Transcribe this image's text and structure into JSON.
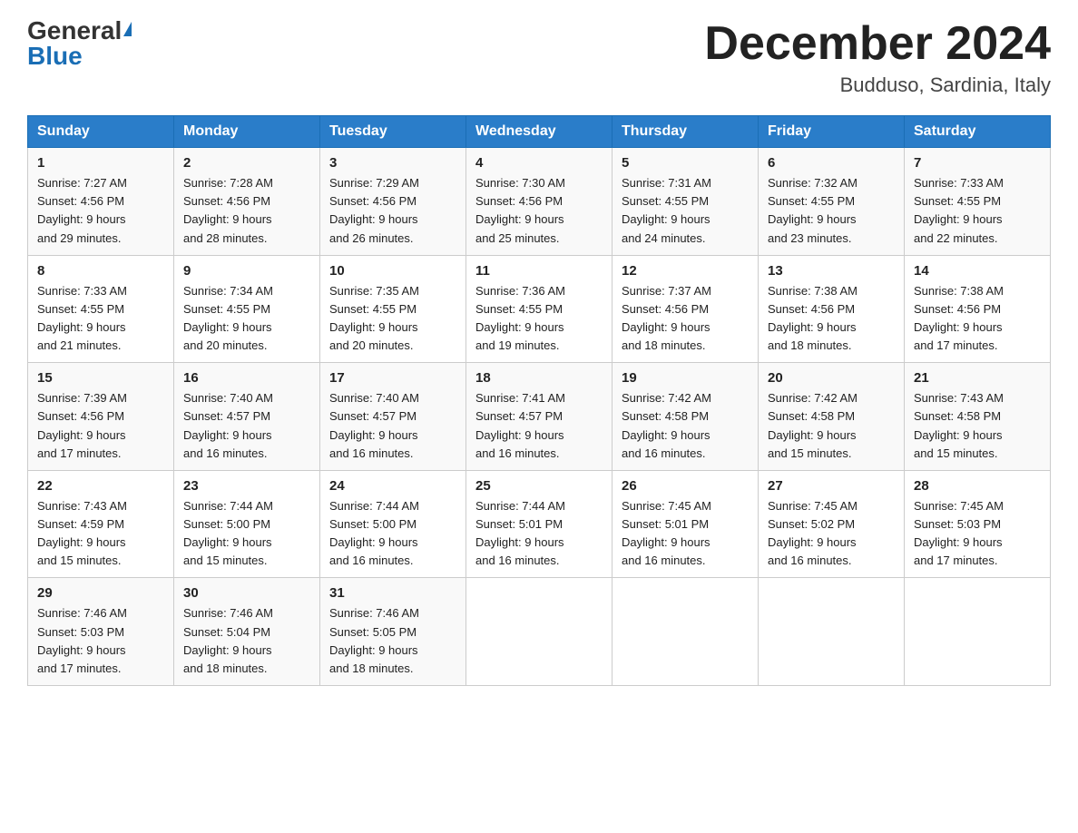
{
  "header": {
    "logo_general": "General",
    "logo_blue": "Blue",
    "month_title": "December 2024",
    "subtitle": "Budduso, Sardinia, Italy"
  },
  "days_of_week": [
    "Sunday",
    "Monday",
    "Tuesday",
    "Wednesday",
    "Thursday",
    "Friday",
    "Saturday"
  ],
  "weeks": [
    [
      {
        "day": "1",
        "sunrise": "7:27 AM",
        "sunset": "4:56 PM",
        "daylight": "9 hours and 29 minutes."
      },
      {
        "day": "2",
        "sunrise": "7:28 AM",
        "sunset": "4:56 PM",
        "daylight": "9 hours and 28 minutes."
      },
      {
        "day": "3",
        "sunrise": "7:29 AM",
        "sunset": "4:56 PM",
        "daylight": "9 hours and 26 minutes."
      },
      {
        "day": "4",
        "sunrise": "7:30 AM",
        "sunset": "4:56 PM",
        "daylight": "9 hours and 25 minutes."
      },
      {
        "day": "5",
        "sunrise": "7:31 AM",
        "sunset": "4:55 PM",
        "daylight": "9 hours and 24 minutes."
      },
      {
        "day": "6",
        "sunrise": "7:32 AM",
        "sunset": "4:55 PM",
        "daylight": "9 hours and 23 minutes."
      },
      {
        "day": "7",
        "sunrise": "7:33 AM",
        "sunset": "4:55 PM",
        "daylight": "9 hours and 22 minutes."
      }
    ],
    [
      {
        "day": "8",
        "sunrise": "7:33 AM",
        "sunset": "4:55 PM",
        "daylight": "9 hours and 21 minutes."
      },
      {
        "day": "9",
        "sunrise": "7:34 AM",
        "sunset": "4:55 PM",
        "daylight": "9 hours and 20 minutes."
      },
      {
        "day": "10",
        "sunrise": "7:35 AM",
        "sunset": "4:55 PM",
        "daylight": "9 hours and 20 minutes."
      },
      {
        "day": "11",
        "sunrise": "7:36 AM",
        "sunset": "4:55 PM",
        "daylight": "9 hours and 19 minutes."
      },
      {
        "day": "12",
        "sunrise": "7:37 AM",
        "sunset": "4:56 PM",
        "daylight": "9 hours and 18 minutes."
      },
      {
        "day": "13",
        "sunrise": "7:38 AM",
        "sunset": "4:56 PM",
        "daylight": "9 hours and 18 minutes."
      },
      {
        "day": "14",
        "sunrise": "7:38 AM",
        "sunset": "4:56 PM",
        "daylight": "9 hours and 17 minutes."
      }
    ],
    [
      {
        "day": "15",
        "sunrise": "7:39 AM",
        "sunset": "4:56 PM",
        "daylight": "9 hours and 17 minutes."
      },
      {
        "day": "16",
        "sunrise": "7:40 AM",
        "sunset": "4:57 PM",
        "daylight": "9 hours and 16 minutes."
      },
      {
        "day": "17",
        "sunrise": "7:40 AM",
        "sunset": "4:57 PM",
        "daylight": "9 hours and 16 minutes."
      },
      {
        "day": "18",
        "sunrise": "7:41 AM",
        "sunset": "4:57 PM",
        "daylight": "9 hours and 16 minutes."
      },
      {
        "day": "19",
        "sunrise": "7:42 AM",
        "sunset": "4:58 PM",
        "daylight": "9 hours and 16 minutes."
      },
      {
        "day": "20",
        "sunrise": "7:42 AM",
        "sunset": "4:58 PM",
        "daylight": "9 hours and 15 minutes."
      },
      {
        "day": "21",
        "sunrise": "7:43 AM",
        "sunset": "4:58 PM",
        "daylight": "9 hours and 15 minutes."
      }
    ],
    [
      {
        "day": "22",
        "sunrise": "7:43 AM",
        "sunset": "4:59 PM",
        "daylight": "9 hours and 15 minutes."
      },
      {
        "day": "23",
        "sunrise": "7:44 AM",
        "sunset": "5:00 PM",
        "daylight": "9 hours and 15 minutes."
      },
      {
        "day": "24",
        "sunrise": "7:44 AM",
        "sunset": "5:00 PM",
        "daylight": "9 hours and 16 minutes."
      },
      {
        "day": "25",
        "sunrise": "7:44 AM",
        "sunset": "5:01 PM",
        "daylight": "9 hours and 16 minutes."
      },
      {
        "day": "26",
        "sunrise": "7:45 AM",
        "sunset": "5:01 PM",
        "daylight": "9 hours and 16 minutes."
      },
      {
        "day": "27",
        "sunrise": "7:45 AM",
        "sunset": "5:02 PM",
        "daylight": "9 hours and 16 minutes."
      },
      {
        "day": "28",
        "sunrise": "7:45 AM",
        "sunset": "5:03 PM",
        "daylight": "9 hours and 17 minutes."
      }
    ],
    [
      {
        "day": "29",
        "sunrise": "7:46 AM",
        "sunset": "5:03 PM",
        "daylight": "9 hours and 17 minutes."
      },
      {
        "day": "30",
        "sunrise": "7:46 AM",
        "sunset": "5:04 PM",
        "daylight": "9 hours and 18 minutes."
      },
      {
        "day": "31",
        "sunrise": "7:46 AM",
        "sunset": "5:05 PM",
        "daylight": "9 hours and 18 minutes."
      },
      null,
      null,
      null,
      null
    ]
  ],
  "labels": {
    "sunrise": "Sunrise:",
    "sunset": "Sunset:",
    "daylight": "Daylight:"
  }
}
